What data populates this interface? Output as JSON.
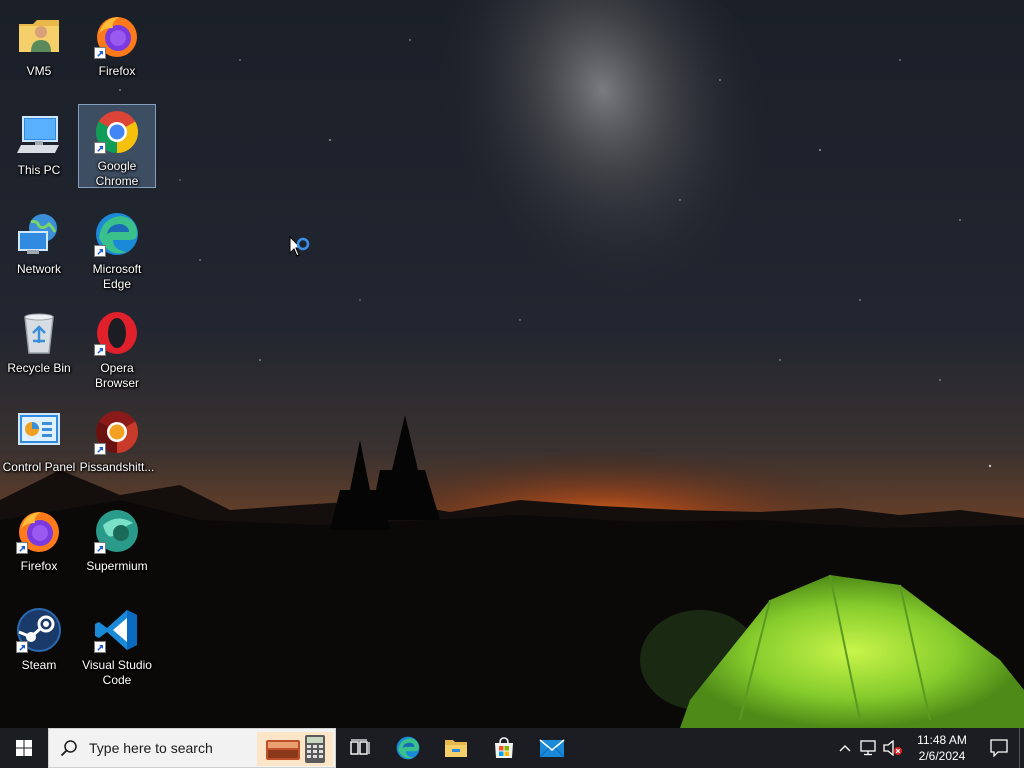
{
  "desktop": {
    "icons": [
      {
        "label": "VM5",
        "icon": "user-folder-icon",
        "shortcut": false,
        "selected": false
      },
      {
        "label": "Firefox",
        "icon": "firefox-icon",
        "shortcut": true,
        "selected": false
      },
      {
        "label": "This PC",
        "icon": "computer-icon",
        "shortcut": false,
        "selected": false
      },
      {
        "label": "Google Chrome",
        "icon": "chrome-icon",
        "shortcut": true,
        "selected": true
      },
      {
        "label": "Network",
        "icon": "network-icon",
        "shortcut": false,
        "selected": false
      },
      {
        "label": "Microsoft Edge",
        "icon": "edge-icon",
        "shortcut": true,
        "selected": false
      },
      {
        "label": "Recycle Bin",
        "icon": "recycle-bin-icon",
        "shortcut": false,
        "selected": false
      },
      {
        "label": "Opera Browser",
        "icon": "opera-icon",
        "shortcut": true,
        "selected": false
      },
      {
        "label": "Control Panel",
        "icon": "control-panel-icon",
        "shortcut": false,
        "selected": false
      },
      {
        "label": "Pissandshitt...",
        "icon": "chromium-fork-icon",
        "shortcut": true,
        "selected": false
      },
      {
        "label": "Firefox",
        "icon": "firefox-icon",
        "shortcut": true,
        "selected": false
      },
      {
        "label": "Supermium",
        "icon": "supermium-icon",
        "shortcut": true,
        "selected": false
      },
      {
        "label": "Steam",
        "icon": "steam-icon",
        "shortcut": true,
        "selected": false
      },
      {
        "label": "Visual Studio Code",
        "icon": "vscode-icon",
        "shortcut": true,
        "selected": false
      }
    ]
  },
  "cursor": {
    "state": "busy",
    "icon": "busy-cursor-icon"
  },
  "taskbar": {
    "start_icon": "windows-logo-icon",
    "search": {
      "placeholder": "Type here to search",
      "icon": "search-icon"
    },
    "pinned": [
      {
        "name": "Task View",
        "icon": "task-view-icon"
      },
      {
        "name": "Microsoft Edge",
        "icon": "edge-icon"
      },
      {
        "name": "File Explorer",
        "icon": "folder-icon"
      },
      {
        "name": "Microsoft Store",
        "icon": "store-icon"
      },
      {
        "name": "Mail",
        "icon": "mail-icon"
      }
    ],
    "tray": {
      "icons": [
        "chevron-up-icon",
        "network-status-icon",
        "volume-muted-icon"
      ],
      "time": "11:48 AM",
      "date": "2/6/2024",
      "action_center_icon": "notification-icon"
    }
  },
  "colors": {
    "taskbar_bg": "#1b1d22",
    "selection": "#7aa0c8",
    "tent": "#8fd43a"
  }
}
